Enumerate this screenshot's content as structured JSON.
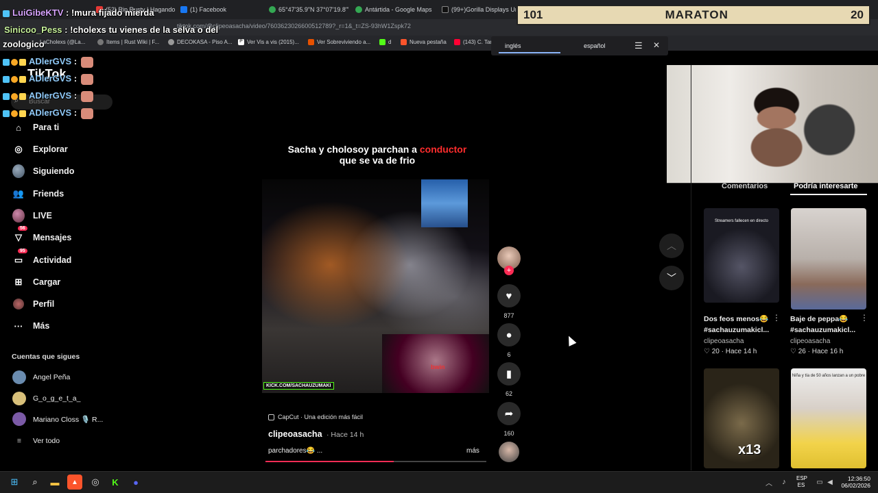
{
  "browser": {
    "tabs": [
      {
        "label": "(52) Rip Rusty | Hagando...",
        "color": "#e53935"
      },
      {
        "label": "(1) Facebook",
        "color": "#1877f2"
      },
      {
        "label": "65°47'35.9\"N 37°07'19.8\"W",
        "color": "#34a853"
      },
      {
        "label": "Antártida - Google Maps",
        "color": "#34a853"
      },
      {
        "label": "(99+)Gorilla Displays Unic...",
        "color": "#111111"
      }
    ],
    "url": "tiktok.com/@clipeoasacha/video/7603623026600512789?_r=1&_t=ZS-93hW1Zspk72",
    "bookmarks": [
      {
        "label": "LaCholexs (@La...",
        "color": "#c62828"
      },
      {
        "label": "Items | Rust Wiki | F...",
        "color": "#777777"
      },
      {
        "label": "DECOKASA - Piso A...",
        "color": "#999999"
      },
      {
        "label": "Ver Vis a vis (2015)...",
        "color": "#444444"
      },
      {
        "label": "Ver Sobreviviendo a...",
        "color": "#e65100"
      },
      {
        "label": "d",
        "color": "#53fc18"
      },
      {
        "label": "Nueva pestaña",
        "color": "#fb542b"
      },
      {
        "label": "(143) C. Tar",
        "color": "#ff0033"
      }
    ],
    "translate": {
      "from": "inglés",
      "to": "español"
    }
  },
  "overlay": {
    "banner": {
      "left": "101",
      "title": "MARATON",
      "right": "20"
    },
    "chat": [
      {
        "name": "LuiGibeKTV",
        "msg": " : !mura fijado mierda"
      },
      {
        "name": "Sinicoo_Pess",
        "msg": " : !cholexs tu vienes de la selva o del"
      },
      {
        "name": "",
        "msg": "zoologico"
      },
      {
        "name": "ADlerGVS",
        "msg": " :"
      },
      {
        "name": "ADlerGVS",
        "msg": " :"
      },
      {
        "name": "ADlerGVS",
        "msg": " :"
      },
      {
        "name": "ADlerGVS",
        "msg": " :"
      }
    ]
  },
  "tiktok": {
    "logo": "TikTok",
    "search_placeholder": "Buscar",
    "nav": [
      {
        "label": "Para ti",
        "icon": "home-icon",
        "glyph": "⌂"
      },
      {
        "label": "Explorar",
        "icon": "compass-icon",
        "glyph": "◎"
      },
      {
        "label": "Siguiendo",
        "icon": "following-avatar",
        "glyph": ""
      },
      {
        "label": "Friends",
        "icon": "friends-icon",
        "glyph": "👥"
      },
      {
        "label": "LIVE",
        "icon": "live-avatar",
        "glyph": ""
      },
      {
        "label": "Mensajes",
        "icon": "messages-icon",
        "glyph": "▽",
        "badge": "56"
      },
      {
        "label": "Actividad",
        "icon": "activity-icon",
        "glyph": "▭",
        "badge": "95"
      },
      {
        "label": "Cargar",
        "icon": "upload-icon",
        "glyph": "⊞"
      },
      {
        "label": "Perfil",
        "icon": "profile-avatar",
        "glyph": ""
      },
      {
        "label": "Más",
        "icon": "more-icon",
        "glyph": "···"
      }
    ],
    "following_title": "Cuentas que sigues",
    "following": [
      {
        "name": "Angel Peña",
        "color": "#6a8caf"
      },
      {
        "name": "G_o_g_e_t_a_",
        "color": "#d8c07a"
      },
      {
        "name": "Mariano Closs 🎙️ R...",
        "color": "#7b5aa6"
      }
    ],
    "see_all": "Ver todo",
    "video": {
      "caption_part1": "Sacha y cholosoy parchan a ",
      "caption_red": "conductor",
      "caption_part2": "que se va de frio",
      "watermark": "KICK.COM/SACHAUZUMAKI",
      "pip_text": "bwin",
      "capcut": "CapCut · Una edición más fácil",
      "author": "clipeoasacha",
      "time": "· Hace 14 h",
      "description": "parchadores😂 ...",
      "more": "más",
      "progress": 0.58
    },
    "actions": {
      "likes": "877",
      "comments": "6",
      "saves": "62",
      "shares": "160"
    },
    "panel": {
      "tab_comments": "Comentarios",
      "tab_suggest": "Podría interesarte",
      "items": [
        {
          "thumb_text": "Streamers fallecen en directo",
          "title1": "Dos feos menos😂",
          "title2": "#sachauzumakicl...",
          "author": "clipeoasacha",
          "likes": "20",
          "time": "Hace 14 h"
        },
        {
          "thumb_text": "",
          "title1": "Baje de peppa😂",
          "title2": "#sachauzumakicl...",
          "author": "clipeoasacha",
          "likes": "26",
          "time": "Hace 16 h"
        },
        {
          "thumb_text": "x13",
          "title1": "",
          "title2": "",
          "author": "",
          "likes": "",
          "time": ""
        },
        {
          "thumb_text": "Niña y tía de 50 años lanzan a un pobre",
          "title1": "",
          "title2": "",
          "author": "",
          "likes": "",
          "time": ""
        }
      ]
    }
  },
  "taskbar": {
    "lang_top": "ESP",
    "lang_bottom": "ES",
    "time": "12:36:50",
    "date": "06/02/2026"
  }
}
